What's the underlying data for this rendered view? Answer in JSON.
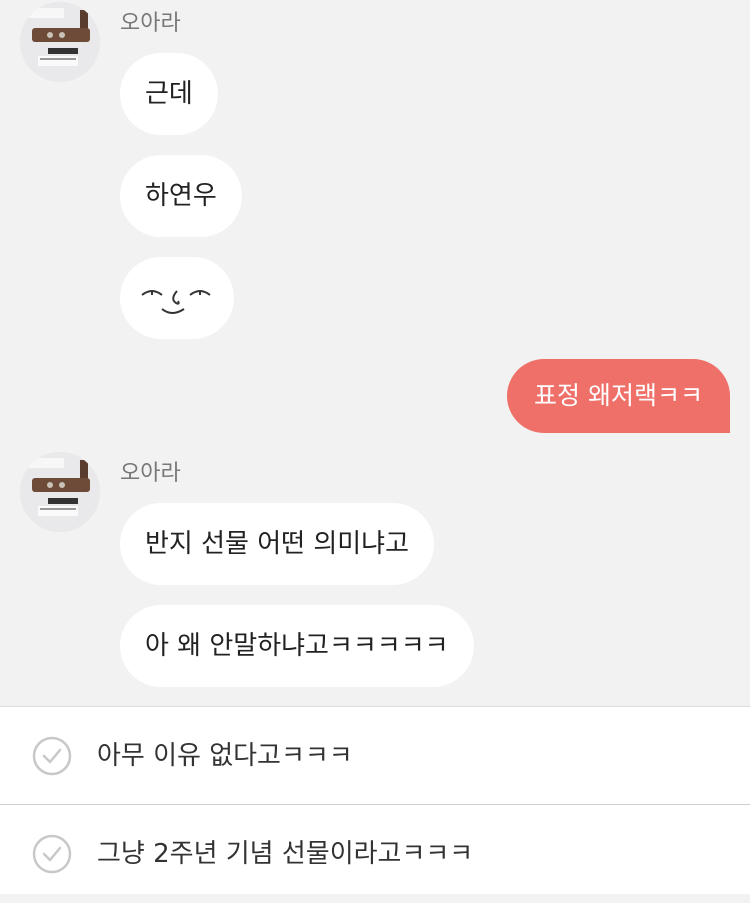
{
  "messages": [
    {
      "sender": "오아라",
      "text": "근데"
    },
    {
      "text": "하연우"
    },
    {
      "text": "",
      "icon": "smug-face-icon"
    },
    {
      "from_me": true,
      "text": "표정 왜저랙ㅋㅋ"
    },
    {
      "sender": "오아라",
      "text": "반지 선물 어떤 의미냐고"
    },
    {
      "text": "아 왜 안말하냐고ㅋㅋㅋㅋㅋ"
    }
  ],
  "replies": [
    {
      "text": "아무 이유 없다고ㅋㅋㅋ"
    },
    {
      "text": "그냥 2주년 기념 선물이라고ㅋㅋㅋ"
    }
  ],
  "colors": {
    "my_bubble": "#ee7068",
    "their_bubble": "#ffffff",
    "background": "#f2f2f2"
  }
}
